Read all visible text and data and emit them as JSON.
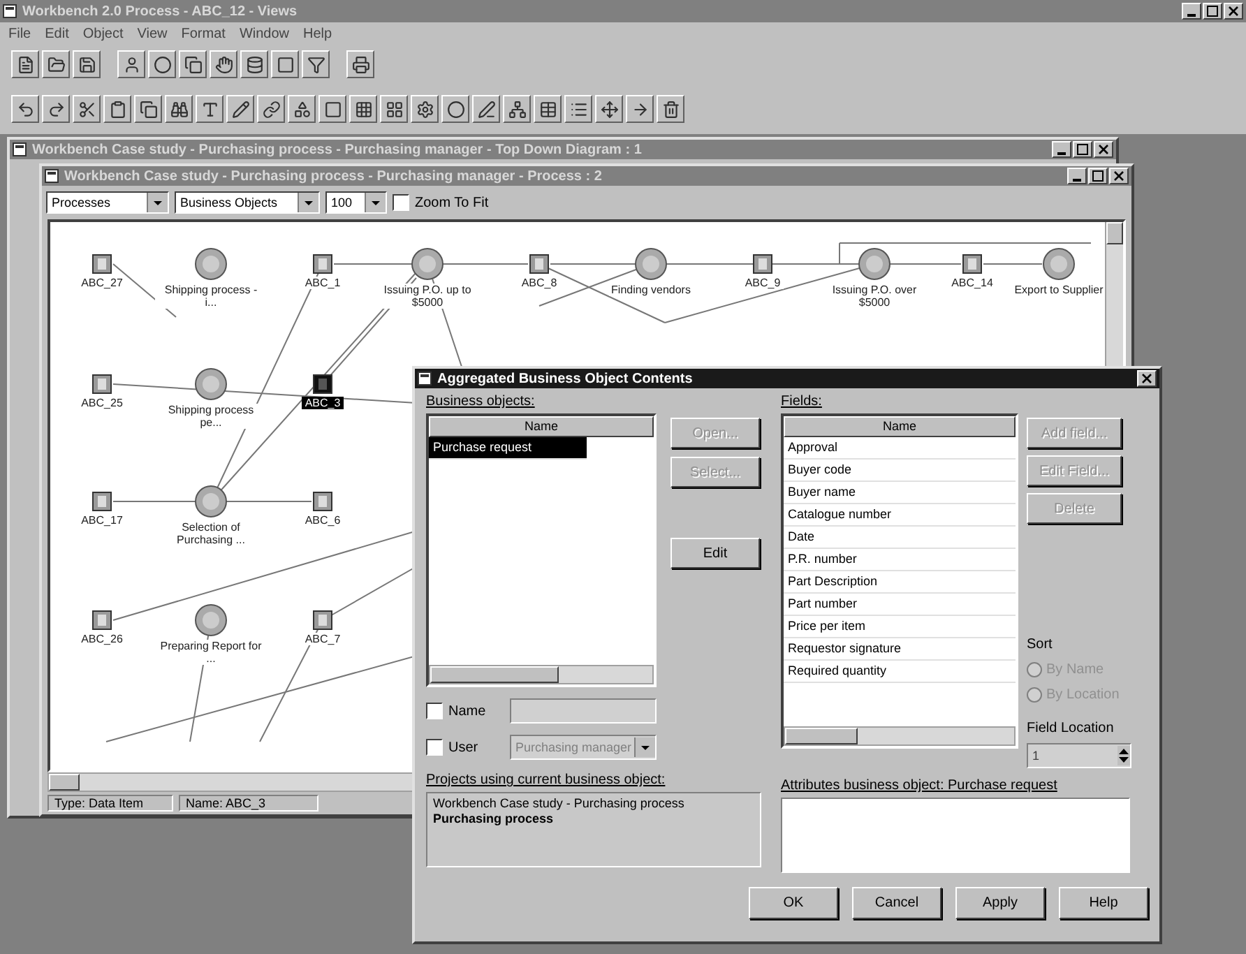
{
  "app": {
    "title": "Workbench 2.0 Process - ABC_12 - Views",
    "menu": [
      "File",
      "Edit",
      "Object",
      "View",
      "Format",
      "Window",
      "Help"
    ]
  },
  "diagram_window": {
    "title": "Workbench Case study - Purchasing process - Purchasing manager - Top Down Diagram : 1"
  },
  "process_window": {
    "title": "Workbench Case study - Purchasing process - Purchasing manager - Process : 2",
    "toolbar": {
      "view_select": "Processes",
      "object_select": "Business Objects",
      "zoom_select": "100",
      "zoom_to_fit": {
        "label": "Zoom To Fit",
        "checked": false
      }
    },
    "nodes": [
      {
        "kind": "data",
        "label": "ABC_27",
        "selected": false
      },
      {
        "kind": "process",
        "label": "Shipping process - i...",
        "selected": false
      },
      {
        "kind": "data",
        "label": "ABC_1",
        "selected": false
      },
      {
        "kind": "process",
        "label": "Issuing P.O. up to $5000",
        "selected": false
      },
      {
        "kind": "data",
        "label": "ABC_8",
        "selected": false
      },
      {
        "kind": "process",
        "label": "Finding vendors",
        "selected": false
      },
      {
        "kind": "data",
        "label": "ABC_9",
        "selected": false
      },
      {
        "kind": "process",
        "label": "Issuing P.O. over $5000",
        "selected": false
      },
      {
        "kind": "data",
        "label": "ABC_14",
        "selected": false
      },
      {
        "kind": "process",
        "label": "Export to Supplier",
        "selected": false
      },
      {
        "kind": "data",
        "label": "ABC_25",
        "selected": false
      },
      {
        "kind": "process",
        "label": "Shipping process pe...",
        "selected": false
      },
      {
        "kind": "data",
        "label": "ABC_3",
        "selected": true
      },
      {
        "kind": "data",
        "label": "ABC_17",
        "selected": false
      },
      {
        "kind": "process",
        "label": "Selection of Purchasing ...",
        "selected": false
      },
      {
        "kind": "data",
        "label": "ABC_6",
        "selected": false
      },
      {
        "kind": "data",
        "label": "ABC_26",
        "selected": false
      },
      {
        "kind": "process",
        "label": "Preparing Report for ...",
        "selected": false
      },
      {
        "kind": "data",
        "label": "ABC_7",
        "selected": false
      }
    ],
    "status_bar": [
      "Type: Data Item",
      "Name: ABC_3"
    ]
  },
  "dialog": {
    "title": "Aggregated Business Object Contents",
    "business_objects": {
      "label": "Business objects:",
      "column": "Name",
      "rows": [
        {
          "name": "Purchase request",
          "selected": true
        }
      ]
    },
    "object_buttons": [
      {
        "label": "Open...",
        "disabled": true
      },
      {
        "label": "Select...",
        "disabled": true
      },
      {
        "label": "Edit",
        "disabled": false
      }
    ],
    "filters": [
      {
        "kind": "text",
        "label": "Name",
        "checked": false
      },
      {
        "kind": "combo",
        "label": "User",
        "checked": false,
        "value": "Purchasing manager"
      }
    ],
    "projects": {
      "label": "Projects using current business object:",
      "items": [
        {
          "text": "Workbench Case study - Purchasing process",
          "bold": false
        },
        {
          "text": "Purchasing process",
          "bold": true
        }
      ]
    },
    "fields": {
      "label": "Fields:",
      "column": "Name",
      "rows": [
        "Approval",
        "Buyer code",
        "Buyer name",
        "Catalogue number",
        "Date",
        "P.R. number",
        "Part Description",
        "Part number",
        "Price per item",
        "Requestor signature",
        "Required quantity"
      ]
    },
    "field_buttons": [
      {
        "label": "Add field...",
        "disabled": true
      },
      {
        "label": "Edit Field...",
        "disabled": true
      },
      {
        "label": "Delete",
        "disabled": true
      }
    ],
    "sort": {
      "label": "Sort",
      "options": [
        {
          "label": "By Name",
          "selected": false,
          "disabled": true
        },
        {
          "label": "By Location",
          "selected": false,
          "disabled": true
        }
      ]
    },
    "field_location": {
      "label": "Field Location",
      "value": "1"
    },
    "attributes": {
      "label": "Attributes business object: Purchase request"
    },
    "buttons": [
      "OK",
      "Cancel",
      "Apply",
      "Help"
    ]
  }
}
